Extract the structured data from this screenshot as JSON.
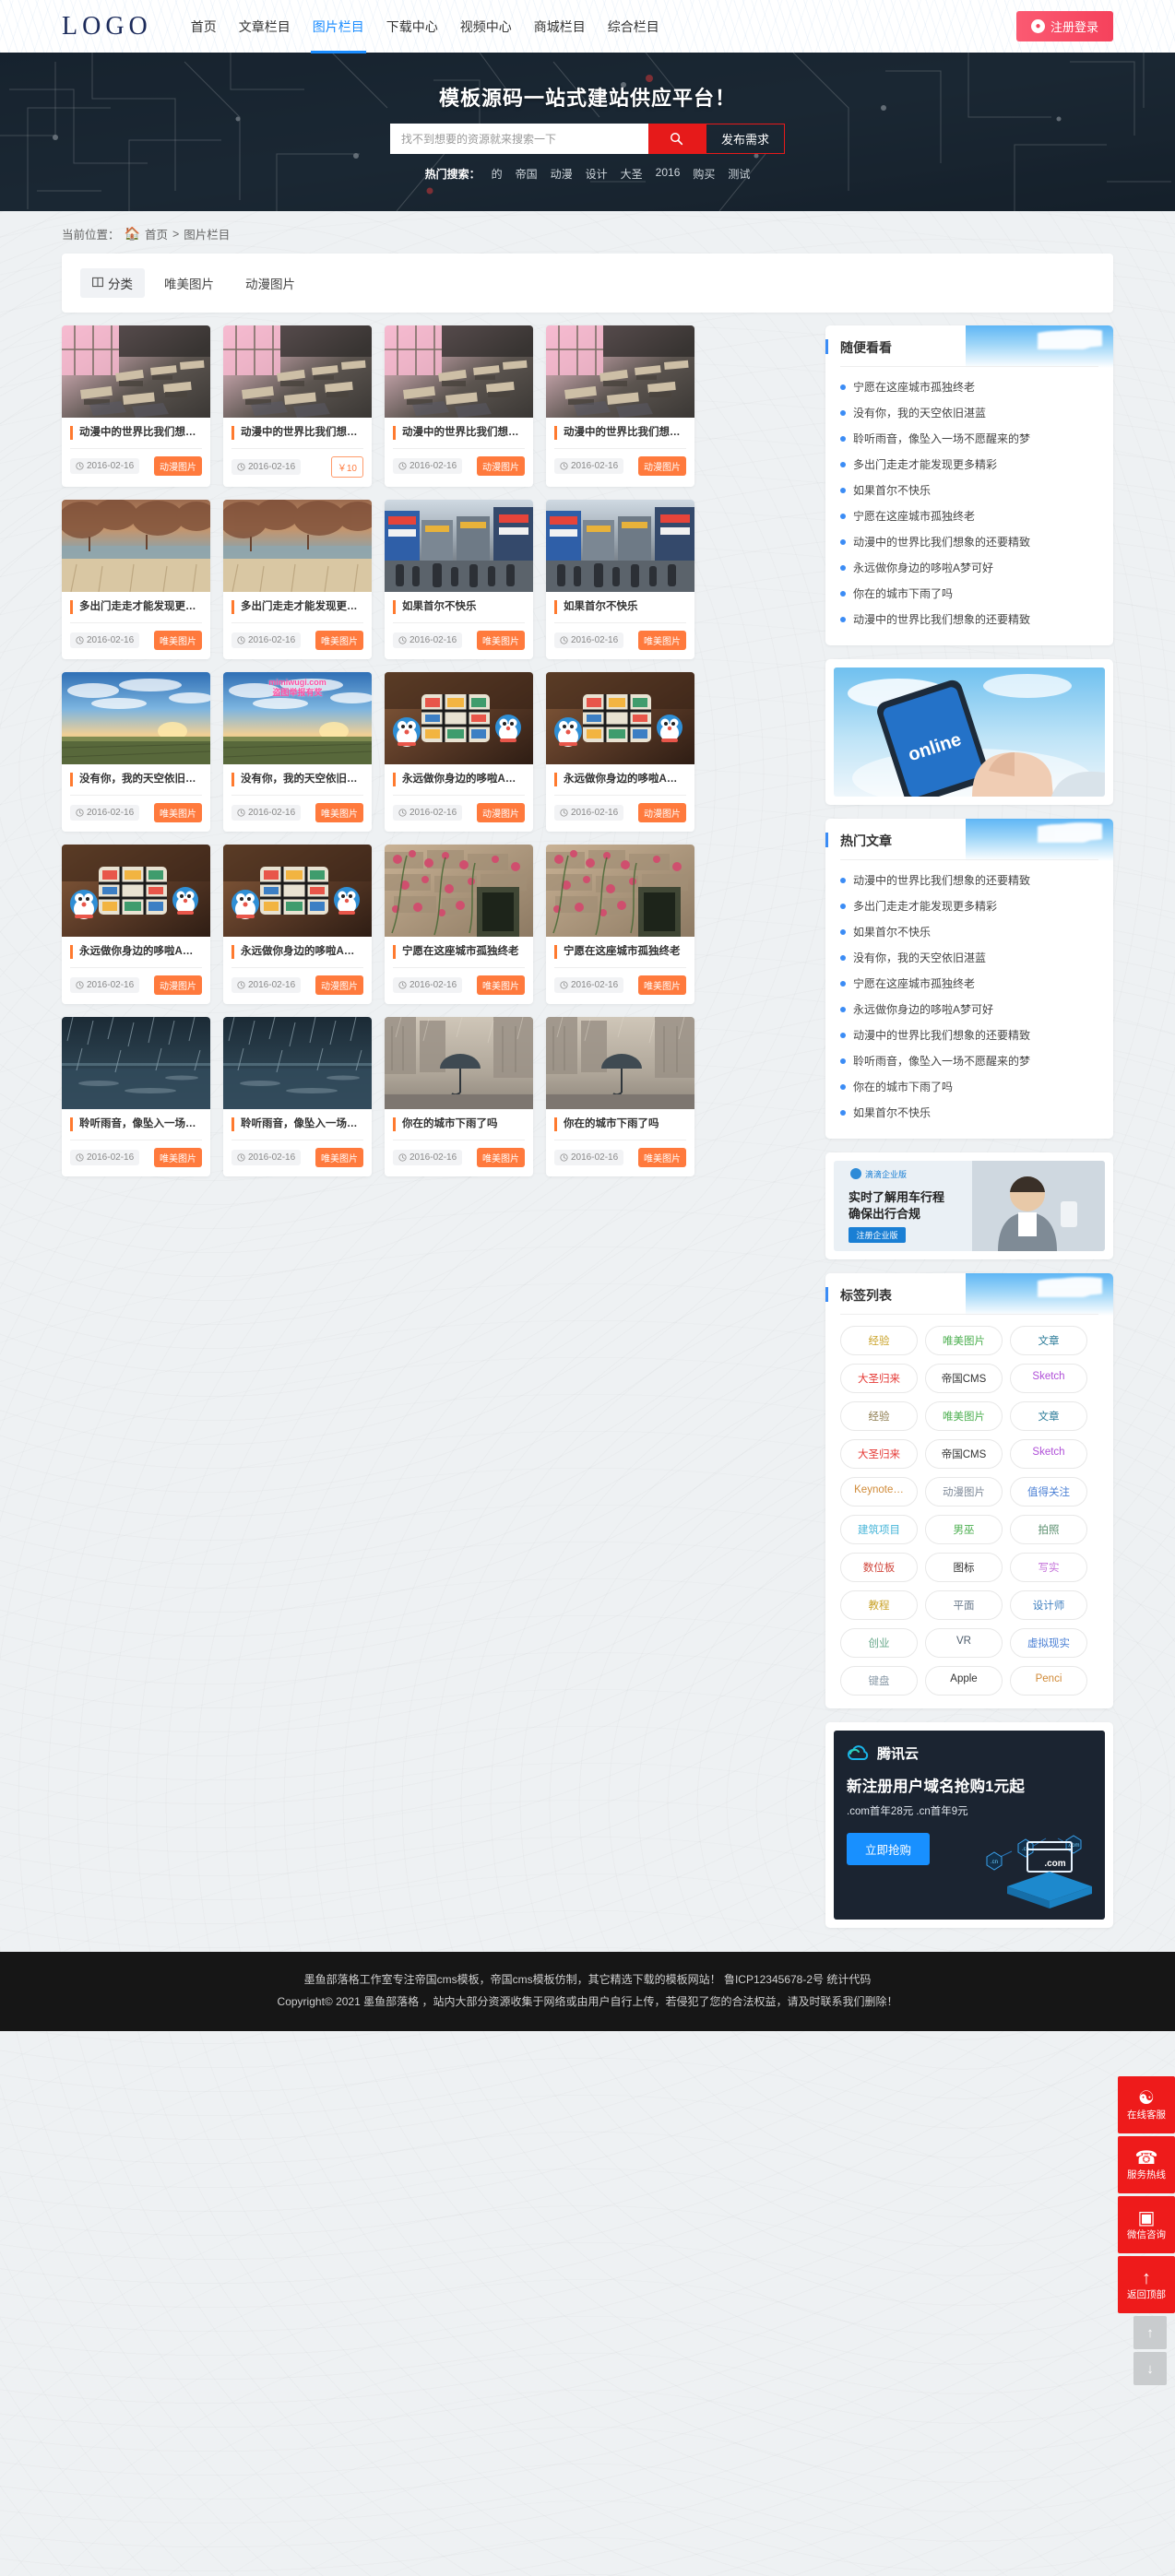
{
  "header": {
    "logo": "LOGO",
    "nav": [
      {
        "label": "首页",
        "active": false
      },
      {
        "label": "文章栏目",
        "active": false
      },
      {
        "label": "图片栏目",
        "active": true
      },
      {
        "label": "下载中心",
        "active": false
      },
      {
        "label": "视频中心",
        "active": false
      },
      {
        "label": "商城栏目",
        "active": false
      },
      {
        "label": "综合栏目",
        "active": false
      }
    ],
    "login_label": "注册登录",
    "login_icon": "user-icon"
  },
  "banner": {
    "title": "模板源码一站式建站供应平台！",
    "search_placeholder": "找不到想要的资源就来搜索一下",
    "search_value": "",
    "search_icon": "search-icon",
    "publish_label": "发布需求",
    "hot_label": "热门搜索：",
    "hot_tags": [
      "的",
      "帝国",
      "动漫",
      "设计",
      "大圣",
      "2016",
      "购买",
      "测试"
    ]
  },
  "breadcrumb": {
    "prefix": "当前位置：",
    "home_icon": "home-icon",
    "items": [
      "首页",
      "图片栏目"
    ],
    "separator": ">"
  },
  "filter": {
    "category_icon": "grid-icon",
    "items": [
      {
        "label": "分类",
        "current": true
      },
      {
        "label": "唯美图片",
        "current": false
      },
      {
        "label": "动漫图片",
        "current": false
      }
    ]
  },
  "cards": [
    {
      "title": "动漫中的世界比我们想象的还要精致",
      "date": "2016-02-16",
      "badge": "动漫图片",
      "badge_type": "tag",
      "image": "classroom",
      "watermark": ""
    },
    {
      "title": "动漫中的世界比我们想象的还要精致",
      "date": "2016-02-16",
      "badge": "￥10",
      "badge_type": "price",
      "image": "classroom",
      "watermark": ""
    },
    {
      "title": "动漫中的世界比我们想象的还要精致",
      "date": "2016-02-16",
      "badge": "动漫图片",
      "badge_type": "tag",
      "image": "classroom",
      "watermark": ""
    },
    {
      "title": "动漫中的世界比我们想象的还要精致",
      "date": "2016-02-16",
      "badge": "动漫图片",
      "badge_type": "tag",
      "image": "classroom",
      "watermark": ""
    },
    {
      "title": "多出门走走才能发现更多精彩",
      "date": "2016-02-16",
      "badge": "唯美图片",
      "badge_type": "tag",
      "image": "autumn",
      "watermark": ""
    },
    {
      "title": "多出门走走才能发现更多精彩",
      "date": "2016-02-16",
      "badge": "唯美图片",
      "badge_type": "tag",
      "image": "autumn",
      "watermark": ""
    },
    {
      "title": "如果首尔不快乐",
      "date": "2016-02-16",
      "badge": "唯美图片",
      "badge_type": "tag",
      "image": "street",
      "watermark": ""
    },
    {
      "title": "如果首尔不快乐",
      "date": "2016-02-16",
      "badge": "唯美图片",
      "badge_type": "tag",
      "image": "street",
      "watermark": ""
    },
    {
      "title": "没有你，我的天空依旧湛蓝",
      "date": "2016-02-16",
      "badge": "唯美图片",
      "badge_type": "tag",
      "image": "field",
      "watermark": ""
    },
    {
      "title": "没有你，我的天空依旧湛蓝",
      "date": "2016-02-16",
      "badge": "唯美图片",
      "badge_type": "tag",
      "image": "field",
      "watermark": "mimiwugi.com\n盗图举报有奖"
    },
    {
      "title": "永远做你身边的哆啦A梦可好",
      "date": "2016-02-16",
      "badge": "动漫图片",
      "badge_type": "tag",
      "image": "doraemon",
      "watermark": ""
    },
    {
      "title": "永远做你身边的哆啦A梦可好",
      "date": "2016-02-16",
      "badge": "动漫图片",
      "badge_type": "tag",
      "image": "doraemon",
      "watermark": ""
    },
    {
      "title": "永远做你身边的哆啦A梦可好",
      "date": "2016-02-16",
      "badge": "动漫图片",
      "badge_type": "tag",
      "image": "doraemon",
      "watermark": ""
    },
    {
      "title": "永远做你身边的哆啦A梦可好",
      "date": "2016-02-16",
      "badge": "动漫图片",
      "badge_type": "tag",
      "image": "doraemon",
      "watermark": ""
    },
    {
      "title": "宁愿在这座城市孤独终老",
      "date": "2016-02-16",
      "badge": "唯美图片",
      "badge_type": "tag",
      "image": "flowers",
      "watermark": ""
    },
    {
      "title": "宁愿在这座城市孤独终老",
      "date": "2016-02-16",
      "badge": "唯美图片",
      "badge_type": "tag",
      "image": "flowers",
      "watermark": ""
    },
    {
      "title": "聆听雨音，像坠入一场不愿醒来的梦",
      "date": "2016-02-16",
      "badge": "唯美图片",
      "badge_type": "tag",
      "image": "rain",
      "watermark": ""
    },
    {
      "title": "聆听雨音，像坠入一场不愿醒来的梦",
      "date": "2016-02-16",
      "badge": "唯美图片",
      "badge_type": "tag",
      "image": "rain",
      "watermark": ""
    },
    {
      "title": "你在的城市下雨了吗",
      "date": "2016-02-16",
      "badge": "唯美图片",
      "badge_type": "tag",
      "image": "umbrella",
      "watermark": ""
    },
    {
      "title": "你在的城市下雨了吗",
      "date": "2016-02-16",
      "badge": "唯美图片",
      "badge_type": "tag",
      "image": "umbrella",
      "watermark": ""
    }
  ],
  "sidebar": {
    "random_panel": {
      "title": "随便看看",
      "items": [
        "宁愿在这座城市孤独终老",
        "没有你，我的天空依旧湛蓝",
        "聆听雨音，像坠入一场不愿醒来的梦",
        "多出门走走才能发现更多精彩",
        "如果首尔不快乐",
        "宁愿在这座城市孤独终老",
        "动漫中的世界比我们想象的还要精致",
        "永远做你身边的哆啦A梦可好",
        "你在的城市下雨了吗",
        "动漫中的世界比我们想象的还要精致"
      ]
    },
    "ad_phone": {
      "alt_icon": "phone-ad-image",
      "badge": "online"
    },
    "hot_panel": {
      "title": "热门文章",
      "items": [
        "动漫中的世界比我们想象的还要精致",
        "多出门走走才能发现更多精彩",
        "如果首尔不快乐",
        "没有你，我的天空依旧湛蓝",
        "宁愿在这座城市孤独终老",
        "永远做你身边的哆啦A梦可好",
        "动漫中的世界比我们想象的还要精致",
        "聆听雨音，像坠入一场不愿醒来的梦",
        "你在的城市下雨了吗",
        "如果首尔不快乐"
      ]
    },
    "ad_didi": {
      "brand": "滴滴企业版",
      "line1": "实时了解用车行程",
      "line2": "确保出行合规",
      "button": "注册企业版"
    },
    "tag_panel": {
      "title": "标签列表",
      "tags": [
        {
          "label": "经验",
          "color": "#c9a227"
        },
        {
          "label": "唯美图片",
          "color": "#4caf50"
        },
        {
          "label": "文章",
          "color": "#2e7d9a"
        },
        {
          "label": "大圣归来",
          "color": "#e53935"
        },
        {
          "label": "帝国CMS",
          "color": "#333333"
        },
        {
          "label": "Sketch",
          "color": "#b050d8"
        },
        {
          "label": "经验",
          "color": "#8d7b4e"
        },
        {
          "label": "唯美图片",
          "color": "#4caf50"
        },
        {
          "label": "文章",
          "color": "#2e7d9a"
        },
        {
          "label": "大圣归来",
          "color": "#e53935"
        },
        {
          "label": "帝国CMS",
          "color": "#333333"
        },
        {
          "label": "Sketch",
          "color": "#b050d8"
        },
        {
          "label": "Keynote…",
          "color": "#d08a38"
        },
        {
          "label": "动漫图片",
          "color": "#7f8a99"
        },
        {
          "label": "值得关注",
          "color": "#4a7fd4"
        },
        {
          "label": "建筑项目",
          "color": "#46b5d8"
        },
        {
          "label": "男巫",
          "color": "#4caf50"
        },
        {
          "label": "拍照",
          "color": "#5b8f6f"
        },
        {
          "label": "数位板",
          "color": "#d0443a"
        },
        {
          "label": "图标",
          "color": "#333333"
        },
        {
          "label": "写实",
          "color": "#c36fd8"
        },
        {
          "label": "教程",
          "color": "#c9a227"
        },
        {
          "label": "平面",
          "color": "#6b7b8c"
        },
        {
          "label": "设计师",
          "color": "#3f7fbf"
        },
        {
          "label": "创业",
          "color": "#67a88b"
        },
        {
          "label": "VR",
          "color": "#4e5d6c"
        },
        {
          "label": "虚拟现实",
          "color": "#4a7fd4"
        },
        {
          "label": "键盘",
          "color": "#8a9aa8"
        },
        {
          "label": "Apple",
          "color": "#333333"
        },
        {
          "label": "Penci",
          "color": "#d08a38"
        }
      ]
    },
    "tencent_ad": {
      "brand": "腾讯云",
      "brand_icon": "cloud-icon",
      "headline": "新注册用户域名抢购1元起",
      "subline": ".com首年28元 .cn首年9元",
      "button": "立即抢购",
      "chips": [
        ".cn",
        ".cn",
        ".com",
        ".com"
      ]
    }
  },
  "float_side": {
    "buttons": [
      {
        "label": "在线客服",
        "icon": "headset-icon"
      },
      {
        "label": "服务热线",
        "icon": "phone-icon"
      },
      {
        "label": "微信咨询",
        "icon": "qrcode-icon"
      },
      {
        "label": "返回顶部",
        "icon": "arrow-up-icon"
      }
    ],
    "small_buttons": [
      {
        "icon": "scroll-top-icon",
        "glyph": "↑"
      },
      {
        "icon": "scroll-bottom-icon",
        "glyph": "↓"
      }
    ]
  },
  "footer": {
    "line1": "墨鱼部落格工作室专注帝国cms模板，帝国cms模板仿制，其它精选下载的模板网站！  鲁ICP12345678-2号 统计代码",
    "line2": "Copyright© 2021  墨鱼部落格 ，站内大部分资源收集于网络或由用户自行上传，若侵犯了您的合法权益，请及时联系我们删除！"
  }
}
